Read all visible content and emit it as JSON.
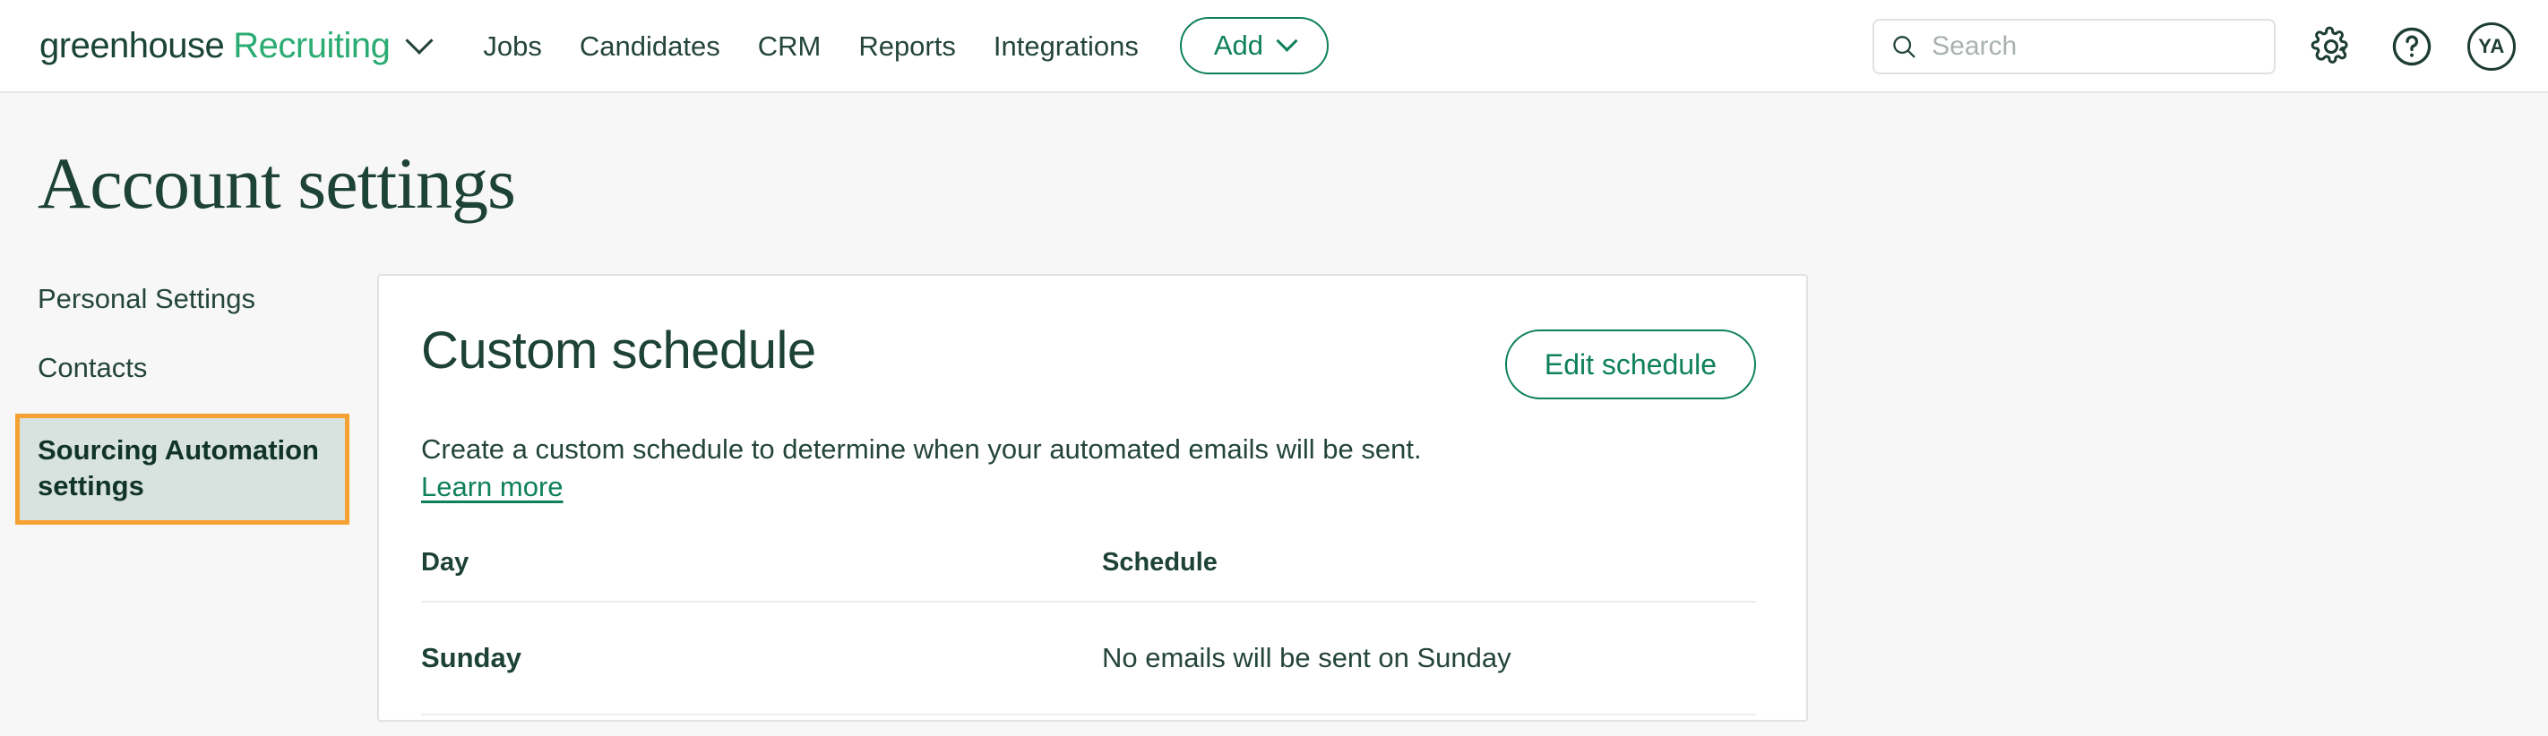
{
  "topbar": {
    "logo": {
      "word1": "greenhouse",
      "word2": "Recruiting",
      "dropdown_icon": "chevron-down-icon"
    },
    "nav": [
      {
        "label": "Jobs"
      },
      {
        "label": "Candidates"
      },
      {
        "label": "CRM"
      },
      {
        "label": "Reports"
      },
      {
        "label": "Integrations"
      }
    ],
    "add_button": {
      "label": "Add",
      "icon": "chevron-down-icon"
    },
    "search": {
      "placeholder": "Search",
      "value": "",
      "icon": "search-icon"
    },
    "settings_icon": "gear-icon",
    "help_icon": "question-circle-icon",
    "avatar": {
      "initials": "YA"
    }
  },
  "page": {
    "title": "Account settings"
  },
  "sidebar": {
    "items": [
      {
        "label": "Personal Settings",
        "active": false
      },
      {
        "label": "Contacts",
        "active": false
      },
      {
        "label": "Sourcing Automation settings",
        "active": true
      }
    ]
  },
  "main": {
    "card": {
      "title": "Custom schedule",
      "edit_button": "Edit schedule",
      "description": "Create a custom schedule to determine when your automated emails will be sent.",
      "learn_more": "Learn more",
      "table": {
        "columns": [
          "Day",
          "Schedule"
        ],
        "rows": [
          {
            "day": "Sunday",
            "schedule": "No emails will be sent on Sunday"
          }
        ]
      }
    }
  },
  "colors": {
    "brand_dark": "#1d4236",
    "brand_green": "#2bac72",
    "accent_green": "#0e8158",
    "highlight_orange": "#f5a133",
    "active_bg": "#d8e2df",
    "page_bg": "#f7f7f7"
  }
}
